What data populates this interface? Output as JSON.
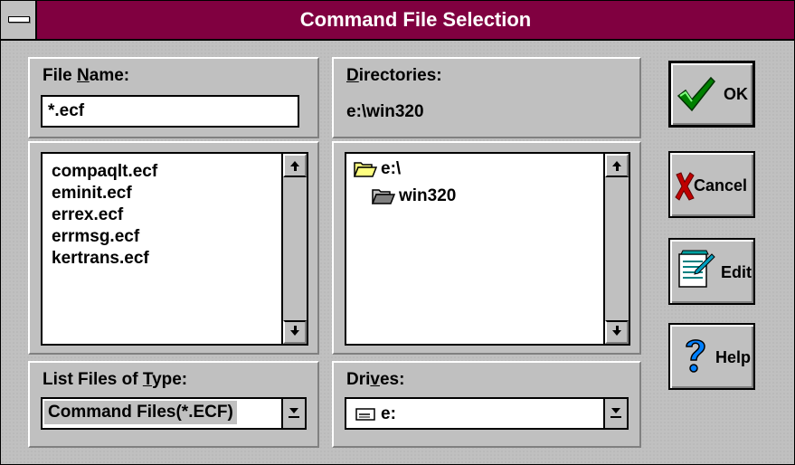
{
  "window": {
    "title": "Command File Selection"
  },
  "file_name": {
    "label_pre": "File ",
    "label_key": "N",
    "label_post": "ame:",
    "value": "*.ecf",
    "files": [
      "compaqlt.ecf",
      "eminit.ecf",
      "errex.ecf",
      "errmsg.ecf",
      "kertrans.ecf"
    ]
  },
  "directories": {
    "label_key": "D",
    "label_post": "irectories:",
    "current": "e:\\win320",
    "tree": [
      {
        "label": "e:\\",
        "state": "open"
      },
      {
        "label": "win320",
        "state": "open-selected"
      }
    ]
  },
  "file_type": {
    "label_pre": "List Files of ",
    "label_key": "T",
    "label_post": "ype:",
    "value": "Command Files(*.ECF)"
  },
  "drives": {
    "label_pre": "Dri",
    "label_key": "v",
    "label_post": "es:",
    "value": "e:"
  },
  "buttons": {
    "ok": "OK",
    "cancel": "Cancel",
    "edit": "Edit",
    "help": "Help"
  },
  "colors": {
    "title_bar": "#800040",
    "face": "#c0c0c0",
    "title_text": "#ffffff"
  },
  "icons": {
    "system_menu": "system-menu-icon",
    "ok": "checkmark-icon",
    "cancel": "x-mark-icon",
    "edit": "notepad-pencil-icon",
    "help": "question-mark-icon",
    "folder": "folder-icon",
    "drive": "drive-icon"
  }
}
